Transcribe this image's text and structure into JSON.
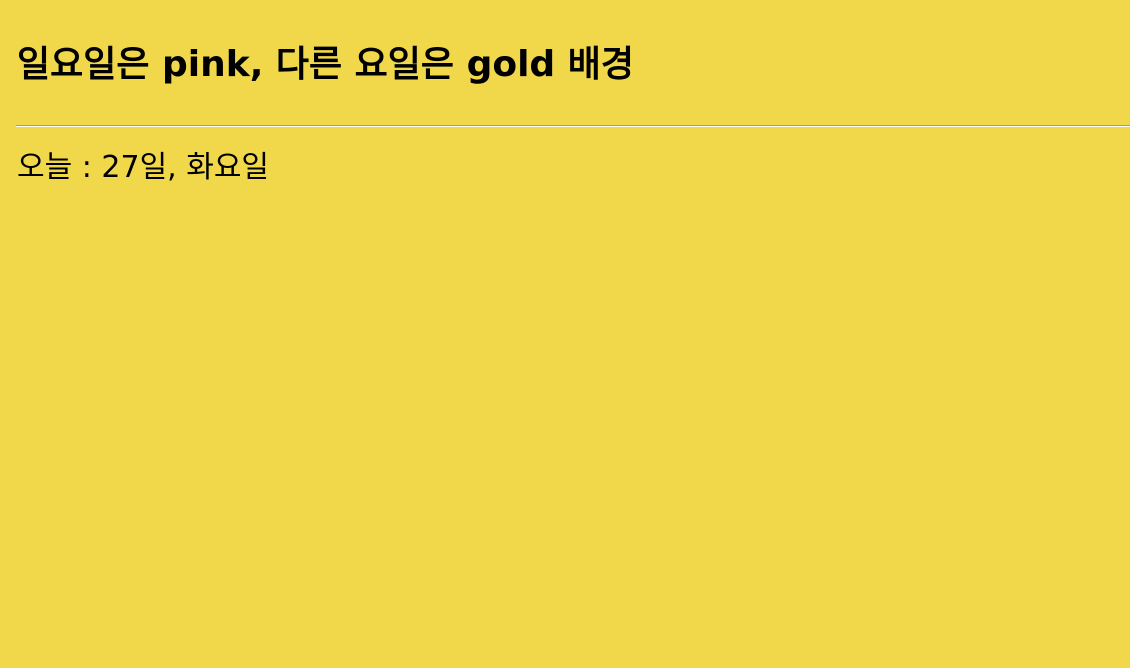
{
  "page": {
    "title": "일요일은 pink, 다른 요일은 gold 배경",
    "background_color": "#f1d74a",
    "today_label": "오늘",
    "separator": " : ",
    "date_text": "27일, 화요일"
  }
}
